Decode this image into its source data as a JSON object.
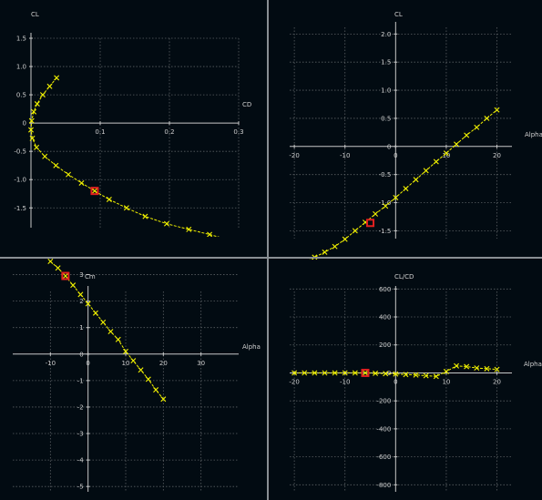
{
  "theme": {
    "background": "#020b12",
    "axis": "#c8c8c8",
    "grid": "#5a5f63",
    "text": "#cfcfcf",
    "series": "#f2f200",
    "highlight": "#e02020",
    "separator": "#8a8f94"
  },
  "chart_data": [
    {
      "id": "polar",
      "type": "line",
      "xlabel": "CD",
      "ylabel": "CL",
      "xlim": [
        0,
        0.3
      ],
      "ylim": [
        -1.85,
        1.5
      ],
      "xticks": [
        0.1,
        0.2,
        0.3
      ],
      "xtick_labels": [
        "0.1",
        "0.2",
        "0.3"
      ],
      "yticks": [
        1.5,
        1.0,
        0.5,
        0,
        -0.5,
        -1.0,
        -1.5
      ],
      "ytick_labels": [
        "1.5",
        "1.0",
        "0.5",
        "0",
        "-0.5",
        "-1.0",
        "-1.5"
      ],
      "grid": true,
      "marker": "x",
      "x": [
        0.037,
        0.027,
        0.017,
        0.009,
        0.004,
        0.001,
        0.0,
        0.002,
        0.008,
        0.02,
        0.036,
        0.054,
        0.073,
        0.092,
        0.113,
        0.138,
        0.165,
        0.196,
        0.228,
        0.258,
        0.288
      ],
      "y": [
        0.8,
        0.65,
        0.5,
        0.34,
        0.2,
        0.04,
        -0.12,
        -0.27,
        -0.43,
        -0.59,
        -0.75,
        -0.91,
        -1.06,
        -1.2,
        -1.35,
        -1.5,
        -1.65,
        -1.78,
        -1.88,
        -1.97,
        -2.07
      ],
      "highlight": {
        "x": 0.092,
        "y": -1.2
      }
    },
    {
      "id": "cl-alpha",
      "type": "line",
      "xlabel": "Alpha",
      "ylabel": "CL",
      "xlim": [
        -22,
        28
      ],
      "ylim": [
        -1.85,
        2.2
      ],
      "xticks": [
        -20,
        -10,
        0,
        10,
        20
      ],
      "xtick_labels": [
        "-20",
        "-10",
        "0",
        "10",
        "20"
      ],
      "yticks": [
        2.0,
        1.5,
        1.0,
        0.5,
        0,
        -0.5,
        -1.0,
        -1.5
      ],
      "ytick_labels": [
        "2.0",
        "1.5",
        "1.0",
        "0.5",
        "0",
        "-0.5",
        "-1.0",
        "-1.5"
      ],
      "grid": true,
      "marker": "x",
      "x": [
        -18,
        -16,
        -14,
        -12,
        -10,
        -8,
        -6,
        -4,
        -2,
        0,
        2,
        4,
        6,
        8,
        10,
        12,
        14,
        16,
        18,
        20
      ],
      "y": [
        -2.07,
        -1.97,
        -1.88,
        -1.78,
        -1.65,
        -1.5,
        -1.35,
        -1.2,
        -1.06,
        -0.91,
        -0.75,
        -0.59,
        -0.43,
        -0.27,
        -0.12,
        0.04,
        0.2,
        0.34,
        0.5,
        0.65
      ],
      "highlight": {
        "x": -5,
        "y": -1.36
      }
    },
    {
      "id": "cm-alpha",
      "type": "line",
      "xlabel": "Alpha",
      "ylabel": "Cm",
      "xlim": [
        -20,
        40
      ],
      "ylim": [
        -5.2,
        3.5
      ],
      "xticks": [
        -10,
        0,
        10,
        20,
        30
      ],
      "xtick_labels": [
        "-10",
        "0",
        "10",
        "20",
        "30"
      ],
      "yticks": [
        3,
        2,
        1,
        0,
        -1,
        -2,
        -3,
        -4,
        -5
      ],
      "ytick_labels": [
        "3",
        "2",
        "1",
        "0",
        "-1",
        "-2",
        "-3",
        "-4",
        "-5"
      ],
      "grid": true,
      "marker": "x",
      "x": [
        -10,
        -8,
        -6,
        -4,
        -2,
        0,
        2,
        4,
        6,
        8,
        10,
        12,
        14,
        16,
        18,
        20
      ],
      "y": [
        3.5,
        3.25,
        2.95,
        2.6,
        2.25,
        1.9,
        1.55,
        1.2,
        0.85,
        0.55,
        0.1,
        -0.25,
        -0.6,
        -0.95,
        -1.35,
        -1.7
      ],
      "highlight": {
        "x": -6,
        "y": 2.95
      }
    },
    {
      "id": "ld-alpha",
      "type": "line",
      "xlabel": "Alpha",
      "ylabel": "CL/CD",
      "xlim": [
        -22,
        28
      ],
      "ylim": [
        -850,
        680
      ],
      "xticks": [
        -20,
        -10,
        0,
        10,
        20
      ],
      "xtick_labels": [
        "-20",
        "-10",
        "0",
        "10",
        "20"
      ],
      "yticks": [
        600,
        400,
        200,
        0,
        -200,
        -400,
        -600,
        -800
      ],
      "ytick_labels": [
        "600",
        "400",
        "200",
        "0",
        "-200",
        "-400",
        "-600",
        "-800"
      ],
      "grid": true,
      "marker": "x",
      "x": [
        -20,
        -18,
        -16,
        -14,
        -12,
        -10,
        -8,
        -6,
        -4,
        -2,
        0,
        2,
        4,
        6,
        8,
        10,
        12,
        14,
        16,
        18,
        20
      ],
      "y": [
        0,
        0,
        0,
        0,
        0,
        0,
        0,
        0,
        -3,
        -5,
        -8,
        -12,
        -15,
        -20,
        -25,
        10,
        50,
        45,
        35,
        30,
        25
      ],
      "highlight": {
        "x": -6,
        "y": 0
      }
    }
  ]
}
